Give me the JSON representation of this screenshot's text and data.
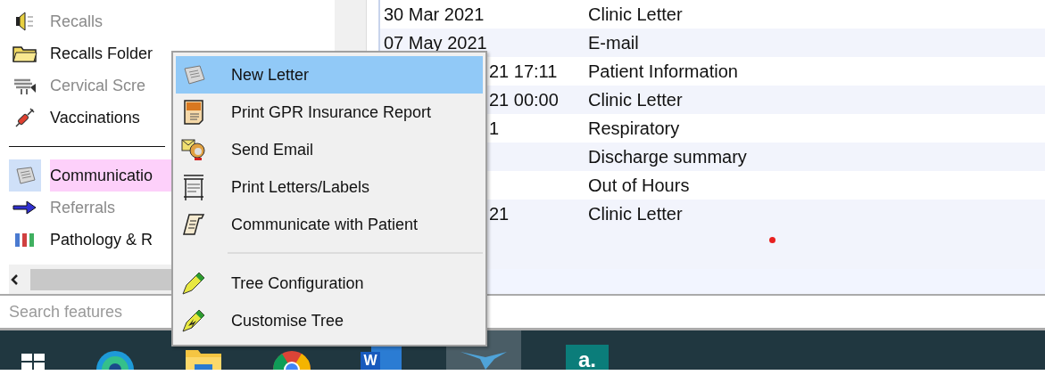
{
  "sidebar": {
    "items": [
      {
        "label": "Recalls",
        "disabled": true,
        "selected": false
      },
      {
        "label": "Recalls Folder",
        "disabled": false,
        "selected": false
      },
      {
        "label": "Cervical Scre",
        "disabled": true,
        "selected": false
      },
      {
        "label": "Vaccinations",
        "disabled": false,
        "selected": false
      },
      {
        "kind": "separator"
      },
      {
        "label": "Communicatio",
        "disabled": false,
        "selected": true
      },
      {
        "label": "Referrals",
        "disabled": true,
        "selected": false
      },
      {
        "label": "Pathology & R",
        "disabled": false,
        "selected": false
      }
    ],
    "search": {
      "placeholder": "Search features"
    }
  },
  "table": {
    "rows": [
      {
        "date": "30 Mar 2021",
        "type": "Clinic Letter"
      },
      {
        "date": "07 May 2021",
        "type": "E-mail"
      },
      {
        "date": "21 17:11",
        "type": "Patient Information"
      },
      {
        "date": "21 00:00",
        "type": "Clinic Letter"
      },
      {
        "date": "1",
        "type": "Respiratory"
      },
      {
        "type": "Discharge summary"
      },
      {
        "type": "Out of Hours"
      },
      {
        "date": "21",
        "type": "Clinic Letter"
      }
    ]
  },
  "context_menu": {
    "items": [
      {
        "label": "New Letter",
        "selected": true
      },
      {
        "label": "Print GPR Insurance Report",
        "selected": false
      },
      {
        "label": "Send Email",
        "selected": false
      },
      {
        "label": "Print Letters/Labels",
        "selected": false
      },
      {
        "label": "Communicate with Patient",
        "selected": false
      },
      {
        "kind": "separator"
      },
      {
        "label": "Tree Configuration",
        "selected": false
      },
      {
        "label": "Customise Tree",
        "selected": false
      }
    ]
  },
  "taskbar": {
    "items": [
      {
        "kind": "start",
        "selected": false
      },
      {
        "kind": "browser",
        "selected": false
      },
      {
        "kind": "folder",
        "selected": false
      },
      {
        "kind": "chrome",
        "selected": false
      },
      {
        "kind": "word",
        "label": "W",
        "selected": false
      },
      {
        "kind": "bird",
        "selected": true
      },
      {
        "kind": "letter-tile",
        "label": "a.",
        "selected": false
      }
    ]
  }
}
